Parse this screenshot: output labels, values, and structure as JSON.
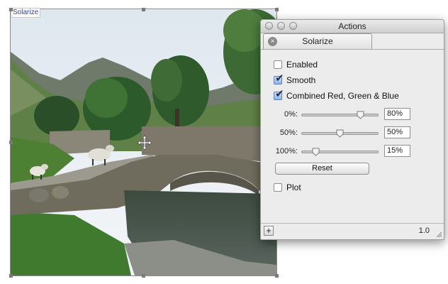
{
  "canvas": {
    "title": "Solarize"
  },
  "window": {
    "title": "Actions",
    "tab_label": "Solarize"
  },
  "options": {
    "enabled": {
      "label": "Enabled",
      "checked": false
    },
    "smooth": {
      "label": "Smooth",
      "checked": true
    },
    "combined": {
      "label": "Combined Red, Green & Blue",
      "checked": true
    }
  },
  "sliders": [
    {
      "label": "0%:",
      "value": "80%",
      "position": 0.78
    },
    {
      "label": "50%:",
      "value": "50%",
      "position": 0.5
    },
    {
      "label": "100%:",
      "value": "15%",
      "position": 0.19
    }
  ],
  "reset_label": "Reset",
  "plot": {
    "label": "Plot",
    "checked": false
  },
  "footer": {
    "add_label": "+",
    "version": "1.0"
  },
  "icons": {
    "close": "close-icon",
    "move": "move-cursor-icon",
    "resize": "resize-grip-icon"
  }
}
